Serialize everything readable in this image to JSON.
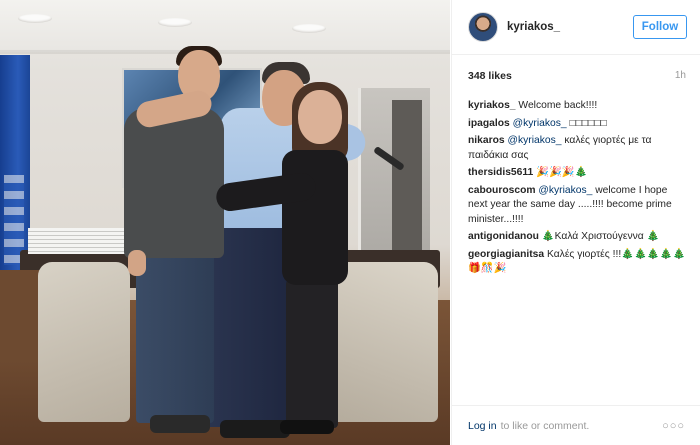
{
  "post": {
    "photo_alt": "Group photo in an office"
  },
  "header": {
    "username": "kyriakos_",
    "follow_label": "Follow"
  },
  "meta": {
    "likes": "348 likes",
    "time_ago": "1h"
  },
  "comments": [
    {
      "user": "kyriakos_",
      "mention": "",
      "text": "Welcome back!!!!"
    },
    {
      "user": "ipagalos",
      "mention": "@kyriakos_",
      "text": "□□□□□□"
    },
    {
      "user": "nikaros",
      "mention": "@kyriakos_",
      "text": "καλές γιορτές με τα παιδάκια σας"
    },
    {
      "user": "thersidis5611",
      "mention": "",
      "text": "🎉🎉🎉🎄"
    },
    {
      "user": "cabouroscom",
      "mention": "@kyriakos_",
      "text": "welcome I hope next year the same day .....!!!! become prime minister...!!!!"
    },
    {
      "user": "antigonidanou",
      "mention": "",
      "text": "🎄Καλά Χριστούγεννα 🎄"
    },
    {
      "user": "georgiagianitsa",
      "mention": "",
      "text": "Καλές γιορτές !!!🎄🎄🎄🎄🎄🎁🎊🎉"
    }
  ],
  "footer": {
    "login_label": "Log in",
    "rest_text": "to like or comment.",
    "more_label": "○○○"
  }
}
